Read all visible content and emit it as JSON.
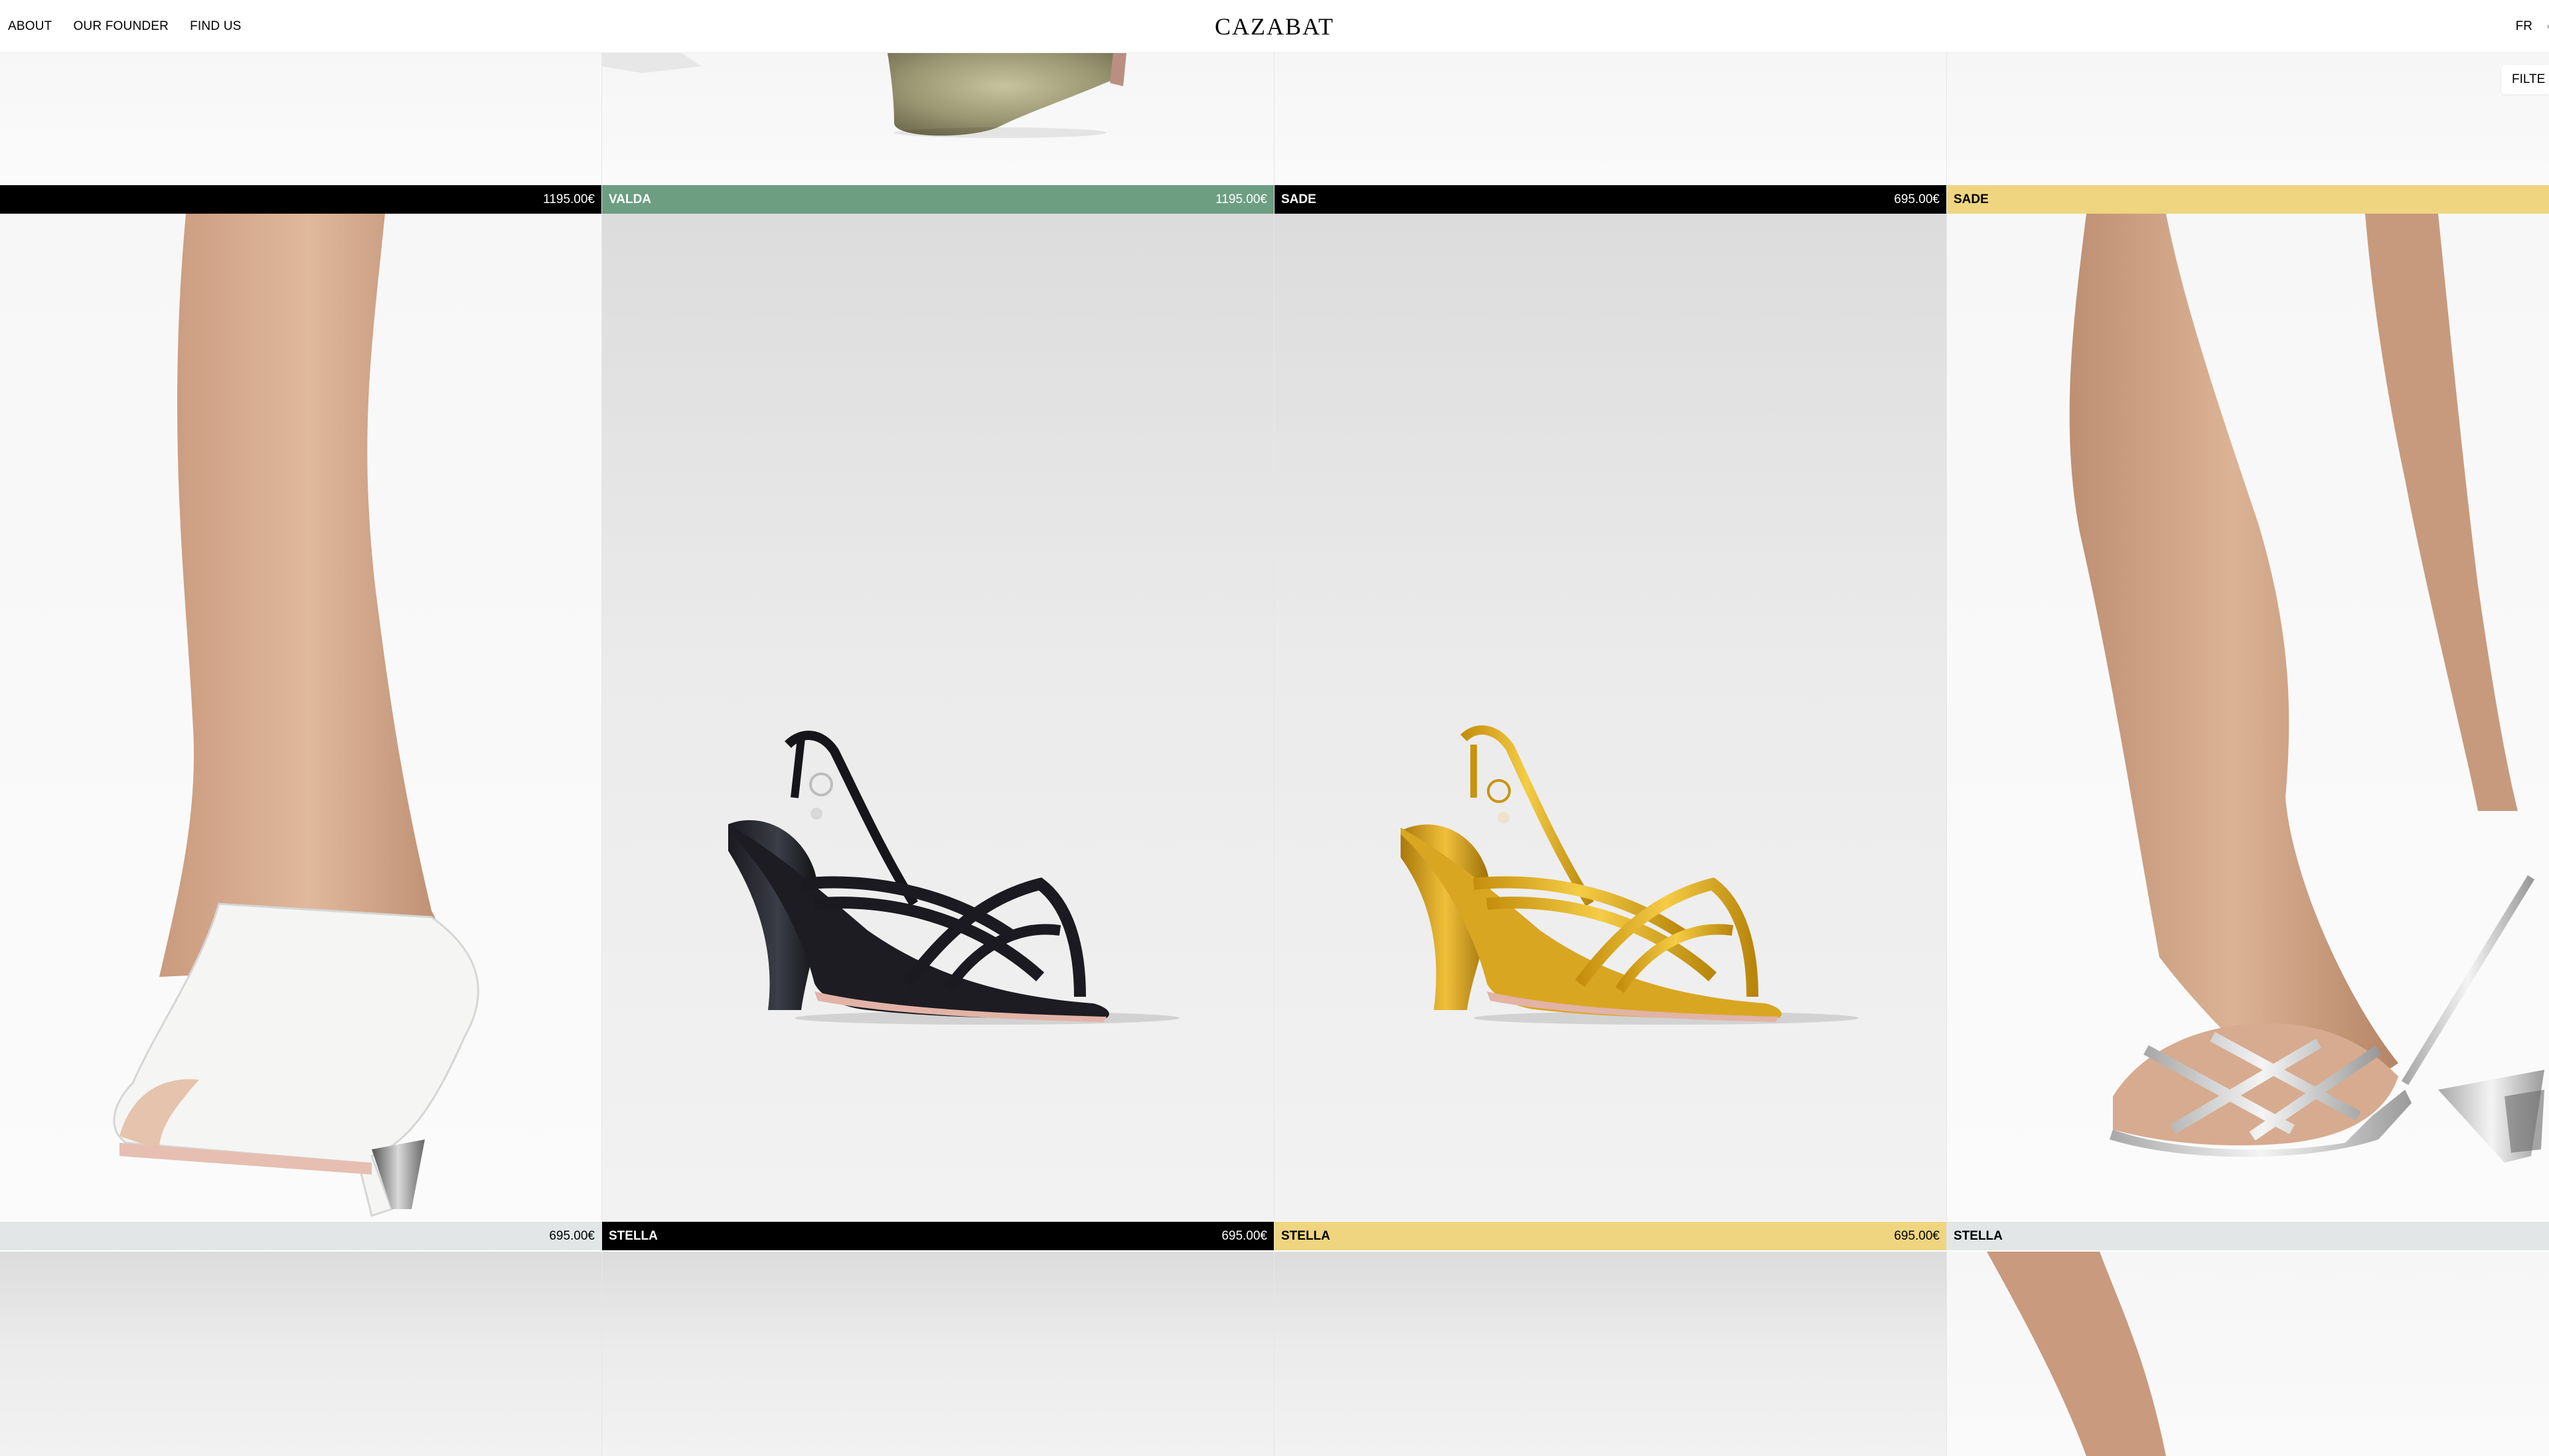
{
  "header": {
    "nav": [
      "ABOUT",
      "OUR FOUNDER",
      "FIND US"
    ],
    "brand": "CAZABAT",
    "language": "FR",
    "filter_label": "FILTE"
  },
  "colors": {
    "black_bar": "#000000",
    "green_bar": "#6d9e82",
    "yellow_bar": "#efd57f",
    "grey_bar": "#e2e6e6"
  },
  "row1_bars": [
    {
      "name": "",
      "price": "1195.00€",
      "color": "#000000",
      "text_color": "#ffffff"
    },
    {
      "name": "VALDA",
      "price": "1195.00€",
      "color": "#6d9e82",
      "text_color": "#ffffff"
    },
    {
      "name": "SADE",
      "price": "695.00€",
      "color": "#000000",
      "text_color": "#ffffff"
    },
    {
      "name": "SADE",
      "price": "",
      "color": "#efd57f",
      "text_color": "#000000"
    }
  ],
  "row2_bars": [
    {
      "name": "",
      "price": "695.00€",
      "color": "#e2e6e6",
      "text_color": "#000000"
    },
    {
      "name": "STELLA",
      "price": "695.00€",
      "color": "#000000",
      "text_color": "#ffffff"
    },
    {
      "name": "STELLA",
      "price": "695.00€",
      "color": "#efd57f",
      "text_color": "#000000"
    },
    {
      "name": "STELLA",
      "price": "",
      "color": "#e2e6e6",
      "text_color": "#000000"
    }
  ],
  "images": {
    "mid": [
      "white-mule-on-foot-photo",
      "black-strappy-sandal-photo",
      "gold-strappy-sandal-photo",
      "silver-sandal-on-foot-photo"
    ]
  }
}
